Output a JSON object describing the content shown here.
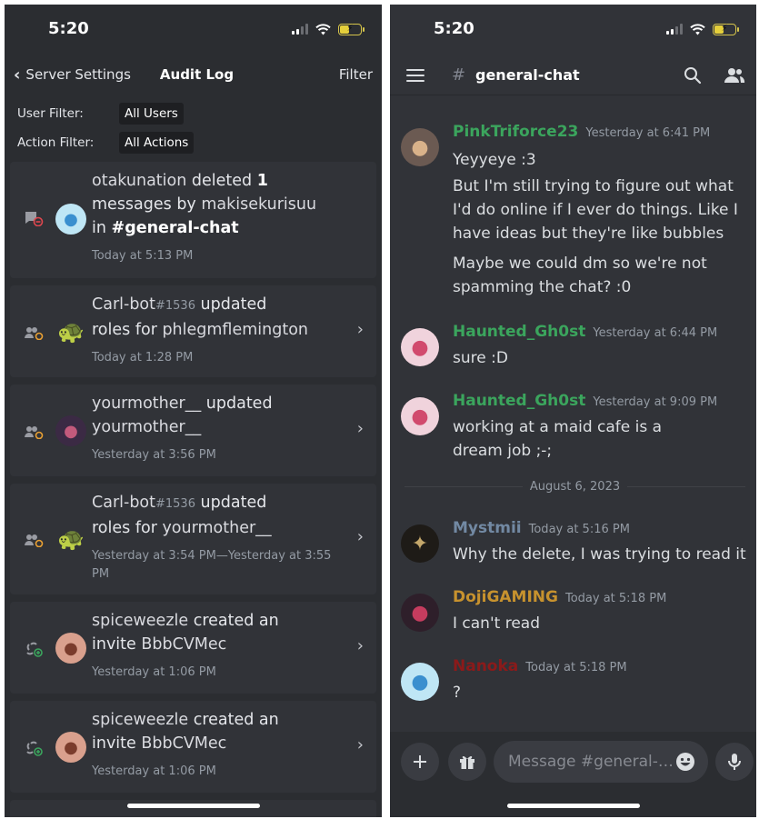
{
  "left": {
    "status_time": "5:20",
    "nav": {
      "back_label": "Server Settings",
      "title": "Audit Log",
      "filter_label": "Filter"
    },
    "filters": {
      "user_label": "User Filter:",
      "user_value": "All Users",
      "action_label": "Action Filter:",
      "action_value": "All Actions"
    },
    "log": [
      {
        "user": "otakunation",
        "verb": " deleted ",
        "count": "1",
        "rest": "messages",
        "by": " by ",
        "target": "makisekurisuu",
        "in": "in ",
        "channel": "#general-chat",
        "time": "Today at 5:13 PM"
      },
      {
        "user": "Carl-bot",
        "tag": "#1536",
        "verb": " updated",
        "line2": "roles for ",
        "target": "phlegmflemington",
        "time": "Today at 1:28 PM"
      },
      {
        "user": "yourmother__",
        "verb": " updated",
        "target": "yourmother__",
        "time": "Yesterday at 3:56 PM"
      },
      {
        "user": "Carl-bot",
        "tag": "#1536",
        "verb": " updated",
        "line2": "roles for ",
        "target": "yourmother__",
        "time": "Yesterday at 3:54 PM—Yesterday at 3:55 PM"
      },
      {
        "user": "spiceweezle",
        "verb": " created an",
        "line2": "invite ",
        "target": "BbbCVMec",
        "time": "Yesterday at 1:06 PM"
      },
      {
        "user": "spiceweezle",
        "verb": " created an",
        "line2": "invite ",
        "target": "BbbCVMec",
        "time": "Yesterday at 1:06 PM"
      }
    ]
  },
  "right": {
    "status_time": "5:20",
    "channel": "general-chat",
    "messages": [
      {
        "user": "PinkTriforce23",
        "color": "#3ba55d",
        "time": "Yesterday at 6:41 PM",
        "lines": [
          "Yeyyeye :3",
          "But I'm still trying to figure out what I'd do online if I ever do things. Like I have ideas but they're like bubbles",
          "Maybe we could dm so we're not spamming the chat? :0"
        ]
      },
      {
        "user": "Haunted_Gh0st",
        "color": "#3ba55d",
        "time": "Yesterday at 6:44 PM",
        "lines": [
          "sure :D"
        ]
      },
      {
        "user": "Haunted_Gh0st",
        "color": "#3ba55d",
        "time": "Yesterday at 9:09 PM",
        "lines": [
          "working at a maid cafe is a dream job ;-;"
        ]
      },
      {
        "user": "Mystmii",
        "color": "#7289a3",
        "time": "Today at 5:16 PM",
        "lines": [
          "Why the delete, I was trying to read it"
        ]
      },
      {
        "user": "DojiGAMING",
        "color": "#c7922e",
        "time": "Today at 5:18 PM",
        "lines": [
          "I can't read"
        ]
      },
      {
        "user": "Nanoka",
        "color": "#8b1a1a",
        "time": "Today at 5:18 PM",
        "lines": [
          "?"
        ]
      }
    ],
    "date_divider": "August 6, 2023",
    "composer_placeholder": "Message #general-…"
  },
  "icons": {
    "back": "chevron-left-icon",
    "item_chevron": "chevron-right-icon",
    "menu": "hamburger-icon",
    "search": "search-icon",
    "members": "members-icon",
    "add": "plus-icon",
    "gift": "gift-icon",
    "emoji": "emoji-icon",
    "mic": "microphone-icon"
  }
}
